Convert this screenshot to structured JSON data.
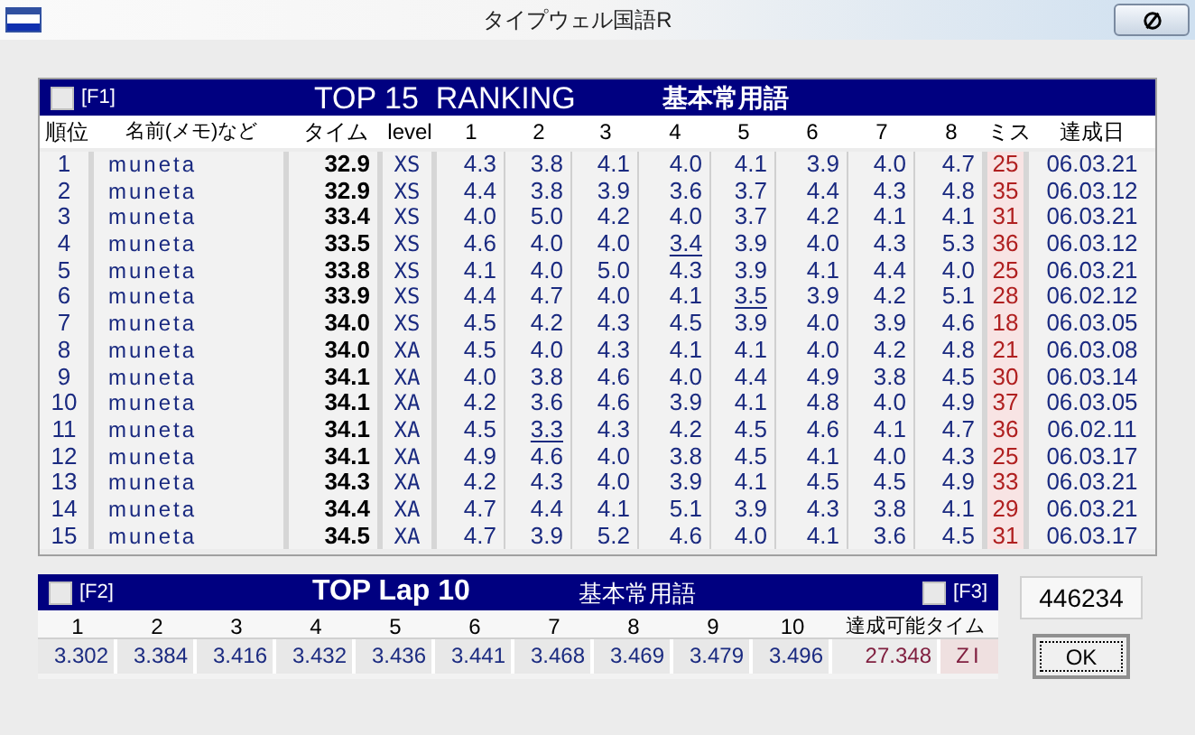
{
  "window": {
    "title": "タイプウェル国語R"
  },
  "ranking": {
    "toggle": {
      "label": "[F1]",
      "checked": false
    },
    "title": "TOP 15  RANKING",
    "category": "基本常用語",
    "columns": [
      "順位",
      "名前(メモ)など",
      "タイム",
      "level",
      "1",
      "2",
      "3",
      "4",
      "5",
      "6",
      "7",
      "8",
      "ミス",
      "達成日"
    ],
    "rows": [
      {
        "rank": "1",
        "name": "muneta",
        "time": "32.9",
        "level": "XS",
        "splits": [
          {
            "value": "4.3",
            "best": false
          },
          {
            "value": "3.8",
            "best": false
          },
          {
            "value": "4.1",
            "best": false
          },
          {
            "value": "4.0",
            "best": false
          },
          {
            "value": "4.1",
            "best": false
          },
          {
            "value": "3.9",
            "best": false
          },
          {
            "value": "4.0",
            "best": false
          },
          {
            "value": "4.7",
            "best": false
          }
        ],
        "miss": "25",
        "date": "06.03.21"
      },
      {
        "rank": "2",
        "name": "muneta",
        "time": "32.9",
        "level": "XS",
        "splits": [
          {
            "value": "4.4",
            "best": false
          },
          {
            "value": "3.8",
            "best": false
          },
          {
            "value": "3.9",
            "best": false
          },
          {
            "value": "3.6",
            "best": false
          },
          {
            "value": "3.7",
            "best": false
          },
          {
            "value": "4.4",
            "best": false
          },
          {
            "value": "4.3",
            "best": false
          },
          {
            "value": "4.8",
            "best": false
          }
        ],
        "miss": "35",
        "date": "06.03.12"
      },
      {
        "rank": "3",
        "name": "muneta",
        "time": "33.4",
        "level": "XS",
        "splits": [
          {
            "value": "4.0",
            "best": false
          },
          {
            "value": "5.0",
            "best": false
          },
          {
            "value": "4.2",
            "best": false
          },
          {
            "value": "4.0",
            "best": false
          },
          {
            "value": "3.7",
            "best": false
          },
          {
            "value": "4.2",
            "best": false
          },
          {
            "value": "4.1",
            "best": false
          },
          {
            "value": "4.1",
            "best": false
          }
        ],
        "miss": "31",
        "date": "06.03.21"
      },
      {
        "rank": "4",
        "name": "muneta",
        "time": "33.5",
        "level": "XS",
        "splits": [
          {
            "value": "4.6",
            "best": false
          },
          {
            "value": "4.0",
            "best": false
          },
          {
            "value": "4.0",
            "best": false
          },
          {
            "value": "3.4",
            "best": true
          },
          {
            "value": "3.9",
            "best": false
          },
          {
            "value": "4.0",
            "best": false
          },
          {
            "value": "4.3",
            "best": false
          },
          {
            "value": "5.3",
            "best": false
          }
        ],
        "miss": "36",
        "date": "06.03.12"
      },
      {
        "rank": "5",
        "name": "muneta",
        "time": "33.8",
        "level": "XS",
        "splits": [
          {
            "value": "4.1",
            "best": false
          },
          {
            "value": "4.0",
            "best": false
          },
          {
            "value": "5.0",
            "best": false
          },
          {
            "value": "4.3",
            "best": false
          },
          {
            "value": "3.9",
            "best": false
          },
          {
            "value": "4.1",
            "best": false
          },
          {
            "value": "4.4",
            "best": false
          },
          {
            "value": "4.0",
            "best": false
          }
        ],
        "miss": "25",
        "date": "06.03.21"
      },
      {
        "rank": "6",
        "name": "muneta",
        "time": "33.9",
        "level": "XS",
        "splits": [
          {
            "value": "4.4",
            "best": false
          },
          {
            "value": "4.7",
            "best": false
          },
          {
            "value": "4.0",
            "best": false
          },
          {
            "value": "4.1",
            "best": false
          },
          {
            "value": "3.5",
            "best": true
          },
          {
            "value": "3.9",
            "best": false
          },
          {
            "value": "4.2",
            "best": false
          },
          {
            "value": "5.1",
            "best": false
          }
        ],
        "miss": "28",
        "date": "06.02.12"
      },
      {
        "rank": "7",
        "name": "muneta",
        "time": "34.0",
        "level": "XS",
        "splits": [
          {
            "value": "4.5",
            "best": false
          },
          {
            "value": "4.2",
            "best": false
          },
          {
            "value": "4.3",
            "best": false
          },
          {
            "value": "4.5",
            "best": false
          },
          {
            "value": "3.9",
            "best": false
          },
          {
            "value": "4.0",
            "best": false
          },
          {
            "value": "3.9",
            "best": false
          },
          {
            "value": "4.6",
            "best": false
          }
        ],
        "miss": "18",
        "date": "06.03.05"
      },
      {
        "rank": "8",
        "name": "muneta",
        "time": "34.0",
        "level": "XA",
        "splits": [
          {
            "value": "4.5",
            "best": false
          },
          {
            "value": "4.0",
            "best": false
          },
          {
            "value": "4.3",
            "best": false
          },
          {
            "value": "4.1",
            "best": false
          },
          {
            "value": "4.1",
            "best": false
          },
          {
            "value": "4.0",
            "best": false
          },
          {
            "value": "4.2",
            "best": false
          },
          {
            "value": "4.8",
            "best": false
          }
        ],
        "miss": "21",
        "date": "06.03.08"
      },
      {
        "rank": "9",
        "name": "muneta",
        "time": "34.1",
        "level": "XA",
        "splits": [
          {
            "value": "4.0",
            "best": false
          },
          {
            "value": "3.8",
            "best": false
          },
          {
            "value": "4.6",
            "best": false
          },
          {
            "value": "4.0",
            "best": false
          },
          {
            "value": "4.4",
            "best": false
          },
          {
            "value": "4.9",
            "best": false
          },
          {
            "value": "3.8",
            "best": false
          },
          {
            "value": "4.5",
            "best": false
          }
        ],
        "miss": "30",
        "date": "06.03.14"
      },
      {
        "rank": "10",
        "name": "muneta",
        "time": "34.1",
        "level": "XA",
        "splits": [
          {
            "value": "4.2",
            "best": false
          },
          {
            "value": "3.6",
            "best": false
          },
          {
            "value": "4.6",
            "best": false
          },
          {
            "value": "3.9",
            "best": false
          },
          {
            "value": "4.1",
            "best": false
          },
          {
            "value": "4.8",
            "best": false
          },
          {
            "value": "4.0",
            "best": false
          },
          {
            "value": "4.9",
            "best": false
          }
        ],
        "miss": "37",
        "date": "06.03.05"
      },
      {
        "rank": "11",
        "name": "muneta",
        "time": "34.1",
        "level": "XA",
        "splits": [
          {
            "value": "4.5",
            "best": false
          },
          {
            "value": "3.3",
            "best": true
          },
          {
            "value": "4.3",
            "best": false
          },
          {
            "value": "4.2",
            "best": false
          },
          {
            "value": "4.5",
            "best": false
          },
          {
            "value": "4.6",
            "best": false
          },
          {
            "value": "4.1",
            "best": false
          },
          {
            "value": "4.7",
            "best": false
          }
        ],
        "miss": "36",
        "date": "06.02.11"
      },
      {
        "rank": "12",
        "name": "muneta",
        "time": "34.1",
        "level": "XA",
        "splits": [
          {
            "value": "4.9",
            "best": false
          },
          {
            "value": "4.6",
            "best": false
          },
          {
            "value": "4.0",
            "best": false
          },
          {
            "value": "3.8",
            "best": false
          },
          {
            "value": "4.5",
            "best": false
          },
          {
            "value": "4.1",
            "best": false
          },
          {
            "value": "4.0",
            "best": false
          },
          {
            "value": "4.3",
            "best": false
          }
        ],
        "miss": "25",
        "date": "06.03.17"
      },
      {
        "rank": "13",
        "name": "muneta",
        "time": "34.3",
        "level": "XA",
        "splits": [
          {
            "value": "4.2",
            "best": false
          },
          {
            "value": "4.3",
            "best": false
          },
          {
            "value": "4.0",
            "best": false
          },
          {
            "value": "3.9",
            "best": false
          },
          {
            "value": "4.1",
            "best": false
          },
          {
            "value": "4.5",
            "best": false
          },
          {
            "value": "4.5",
            "best": false
          },
          {
            "value": "4.9",
            "best": false
          }
        ],
        "miss": "33",
        "date": "06.03.21"
      },
      {
        "rank": "14",
        "name": "muneta",
        "time": "34.4",
        "level": "XA",
        "splits": [
          {
            "value": "4.7",
            "best": false
          },
          {
            "value": "4.4",
            "best": false
          },
          {
            "value": "4.1",
            "best": false
          },
          {
            "value": "5.1",
            "best": false
          },
          {
            "value": "3.9",
            "best": false
          },
          {
            "value": "4.3",
            "best": false
          },
          {
            "value": "3.8",
            "best": false
          },
          {
            "value": "4.1",
            "best": false
          }
        ],
        "miss": "29",
        "date": "06.03.21"
      },
      {
        "rank": "15",
        "name": "muneta",
        "time": "34.5",
        "level": "XA",
        "splits": [
          {
            "value": "4.7",
            "best": false
          },
          {
            "value": "3.9",
            "best": false
          },
          {
            "value": "5.2",
            "best": false
          },
          {
            "value": "4.6",
            "best": false
          },
          {
            "value": "4.0",
            "best": false
          },
          {
            "value": "4.1",
            "best": false
          },
          {
            "value": "3.6",
            "best": false
          },
          {
            "value": "4.5",
            "best": false
          }
        ],
        "miss": "31",
        "date": "06.03.17"
      }
    ]
  },
  "laps": {
    "toggle": {
      "label": "[F2]",
      "checked": false
    },
    "title": "TOP Lap 10",
    "category": "基本常用語",
    "toggle_right": {
      "label": "[F3]",
      "checked": false
    },
    "columns": [
      "1",
      "2",
      "3",
      "4",
      "5",
      "6",
      "7",
      "8",
      "9",
      "10",
      "達成可能タイム"
    ],
    "values": [
      "3.302",
      "3.384",
      "3.416",
      "3.432",
      "3.436",
      "3.441",
      "3.468",
      "3.469",
      "3.479",
      "3.496"
    ],
    "possible_time": "27.348",
    "possible_level": "ZI"
  },
  "counter": "446234",
  "ok_button": "OK"
}
